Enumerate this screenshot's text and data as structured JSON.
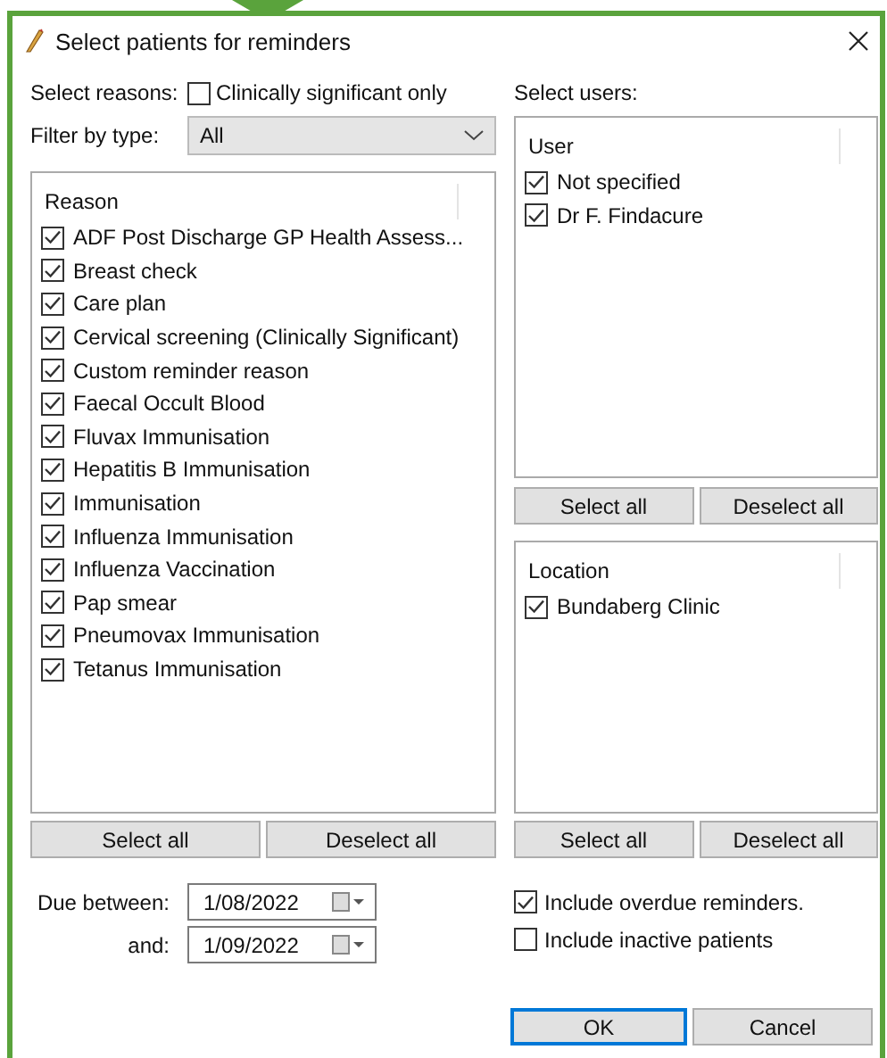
{
  "window": {
    "title": "Select patients for reminders"
  },
  "reasons": {
    "label": "Select reasons:",
    "clinically_significant": {
      "label": "Clinically significant only",
      "checked": false
    },
    "filter": {
      "label": "Filter by type:",
      "value": "All"
    },
    "list": {
      "header": "Reason",
      "items": [
        {
          "label": "ADF Post Discharge GP Health Assess...",
          "checked": true
        },
        {
          "label": "Breast check",
          "checked": true
        },
        {
          "label": "Care plan",
          "checked": true
        },
        {
          "label": "Cervical screening (Clinically Significant)",
          "checked": true
        },
        {
          "label": "Custom reminder reason",
          "checked": true
        },
        {
          "label": "Faecal Occult Blood",
          "checked": true
        },
        {
          "label": "Fluvax Immunisation",
          "checked": true
        },
        {
          "label": "Hepatitis B Immunisation",
          "checked": true
        },
        {
          "label": "Immunisation",
          "checked": true
        },
        {
          "label": "Influenza Immunisation",
          "checked": true
        },
        {
          "label": "Influenza Vaccination",
          "checked": true
        },
        {
          "label": "Pap smear",
          "checked": true
        },
        {
          "label": "Pneumovax Immunisation",
          "checked": true
        },
        {
          "label": "Tetanus Immunisation",
          "checked": true
        }
      ]
    },
    "buttons": [
      "Select all",
      "Deselect all"
    ]
  },
  "users": {
    "label": "Select users:",
    "list": {
      "header": "User",
      "items": [
        {
          "label": "Not specified",
          "checked": true
        },
        {
          "label": "Dr F. Findacure",
          "checked": true
        }
      ]
    },
    "buttons": [
      "Select all",
      "Deselect all"
    ]
  },
  "locations": {
    "list": {
      "header": "Location",
      "items": [
        {
          "label": "Bundaberg Clinic",
          "checked": true
        }
      ]
    },
    "buttons": [
      "Select all",
      "Deselect all"
    ]
  },
  "due": {
    "from": {
      "label": "Due between:",
      "value": "1/08/2022"
    },
    "to": {
      "label": "and:",
      "value": "1/09/2022"
    }
  },
  "options": [
    {
      "label": "Include overdue reminders.",
      "checked": true
    },
    {
      "label": "Include inactive patients",
      "checked": false
    }
  ],
  "buttons": [
    {
      "label": "OK",
      "default": true
    },
    {
      "label": "Cancel",
      "default": false
    }
  ]
}
